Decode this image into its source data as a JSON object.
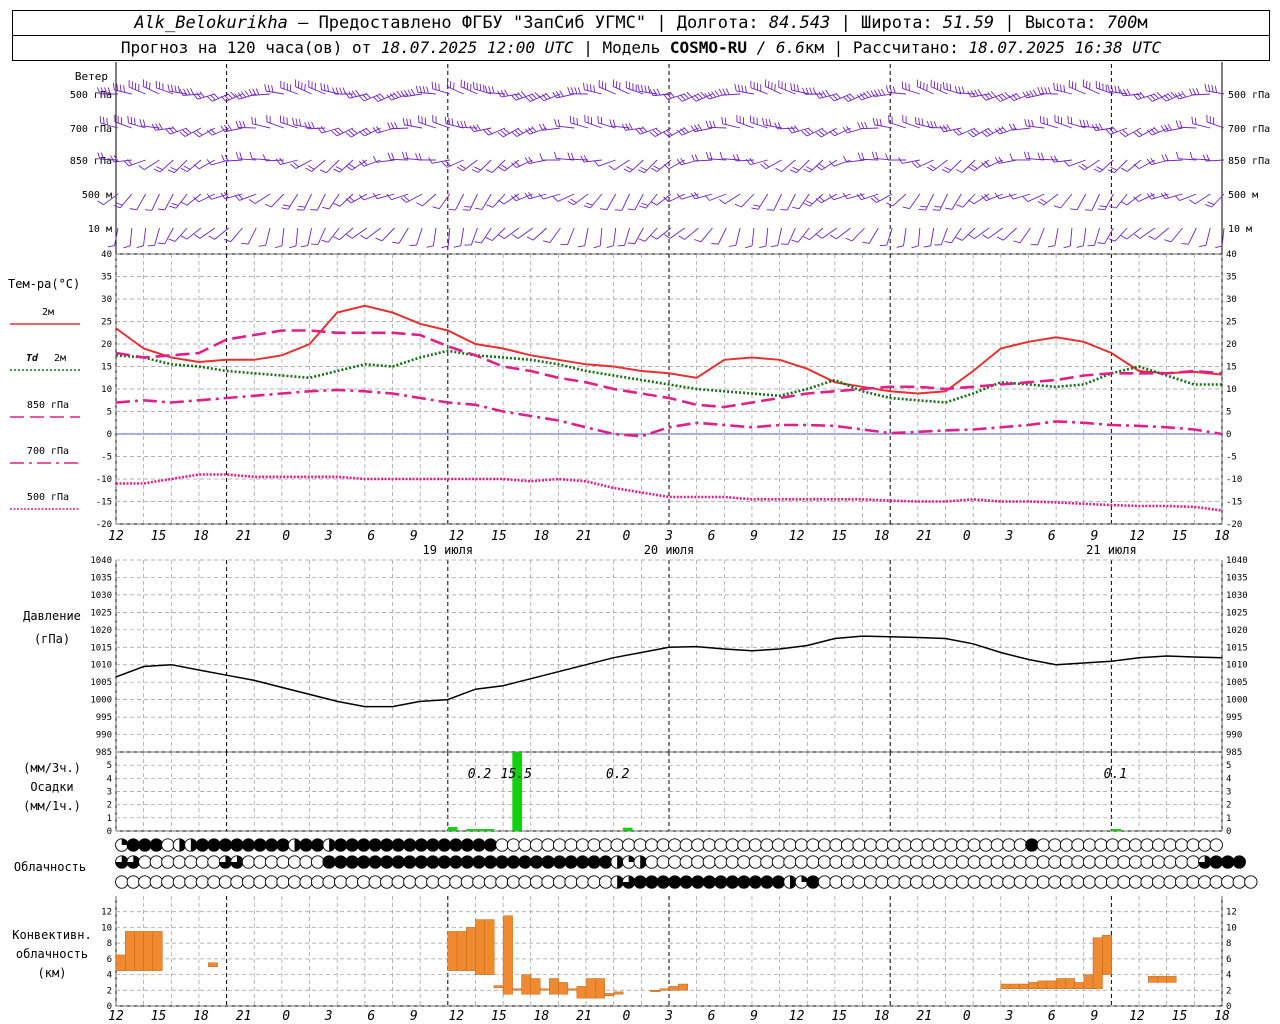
{
  "header": {
    "station": "Alk_Belokurikha",
    "provider": " – Предоставлено ФГБУ \"ЗапСиб УГМС\" | Долгота: ",
    "lon": "84.543",
    "lat_label": " | Широта: ",
    "lat": "51.59",
    "alt_label": " | Высота: ",
    "alt": "700",
    "alt_unit": "м",
    "forecast_label": "Прогноз на 120 часа(ов) от ",
    "start": "18.07.2025 12:00 UTC",
    "model_label": "  | Модель ",
    "model": "COSMO-RU",
    "res": " / 6.6",
    "res_unit": "км",
    "calc_label": " | Рассчитано: ",
    "calc": "18.07.2025 16:38 UTC"
  },
  "colors": {
    "wind": "#7020c0",
    "t2m": "#e83030",
    "td2m": "#157015",
    "t850": "#e0208a",
    "t700": "#e0208a",
    "t500": "#e0208a",
    "pressure": "#000000",
    "precip": "#10d010",
    "conv": "#f08a30",
    "zero_line": "#3030d0",
    "grid": "#999999"
  },
  "chart_data": [
    {
      "type": "wind_barbs",
      "title": "Ветер",
      "levels": [
        "500 гПа",
        "700 гПа",
        "850 гПа",
        "500 м",
        "10  м"
      ],
      "level_speed_ms": [
        18,
        14,
        9,
        6,
        4
      ],
      "level_dir_deg": [
        270,
        265,
        250,
        230,
        210
      ]
    },
    {
      "type": "line",
      "title": "Тем-ра(°С)",
      "ylim": [
        -20,
        40
      ],
      "yticks": [
        -20,
        -15,
        -10,
        -5,
        0,
        5,
        10,
        15,
        20,
        25,
        30,
        35,
        40
      ],
      "x_hours": [
        0,
        3,
        6,
        9,
        12,
        15,
        18,
        21,
        24,
        27,
        30,
        33,
        36,
        39,
        42,
        45,
        48,
        51,
        54,
        57,
        60,
        63,
        66,
        69,
        72,
        75,
        78,
        81,
        84,
        87,
        90,
        93,
        96,
        99,
        102,
        105,
        108,
        111,
        114,
        117,
        120
      ],
      "series": [
        {
          "name": "2м",
          "key": "t2m",
          "style": "solid",
          "values": [
            23.5,
            19,
            17,
            16,
            16.5,
            16.5,
            17.5,
            20,
            27,
            28.5,
            27,
            24.5,
            23,
            20,
            19,
            17.5,
            16.5,
            15.5,
            15,
            14,
            13.5,
            12.5,
            16.5,
            17,
            16.5,
            14.5,
            11.5,
            10.5,
            9.5,
            9,
            9.5,
            14,
            19,
            20.5,
            21.5,
            20.5,
            18,
            14,
            13.5,
            13.8,
            13.2
          ]
        },
        {
          "name": "Td 2м",
          "key": "td2m",
          "style": "dot",
          "values": [
            17.5,
            17,
            15.5,
            15,
            14,
            13.5,
            13,
            12.5,
            14,
            15.5,
            15,
            17,
            18.5,
            17.5,
            17,
            16.5,
            15.5,
            14,
            13,
            12,
            11,
            10,
            9.5,
            9,
            8.5,
            10,
            12,
            9.5,
            8,
            7.5,
            7,
            9,
            11.5,
            11,
            10.5,
            11,
            13.5,
            15,
            13,
            11,
            11
          ]
        },
        {
          "name": "850 гПа",
          "key": "t850",
          "style": "dash",
          "values": [
            18,
            17,
            17.5,
            18,
            21,
            22,
            23,
            23,
            22.5,
            22.5,
            22.5,
            22,
            19.5,
            17.5,
            15,
            14,
            12.5,
            11.5,
            10,
            9,
            8,
            6.5,
            6,
            7,
            8,
            9,
            9.5,
            10,
            10.5,
            10.5,
            10,
            10.5,
            11,
            11.5,
            12,
            13,
            13.5,
            13.5,
            13.5,
            14,
            13.5
          ]
        },
        {
          "name": "700 гПа",
          "key": "t700",
          "style": "dashdot",
          "values": [
            7,
            7.5,
            7,
            7.5,
            8,
            8.5,
            9,
            9.5,
            9.8,
            9.5,
            9,
            8,
            7,
            6.5,
            5,
            4,
            3,
            1.5,
            0,
            -0.5,
            1.5,
            2.5,
            2,
            1.5,
            2,
            2,
            1.8,
            1,
            0.2,
            0.5,
            0.8,
            1,
            1.5,
            2,
            2.8,
            2.5,
            2,
            1.8,
            1.5,
            1,
            0
          ]
        },
        {
          "name": "500 гПа",
          "key": "t500",
          "style": "dense",
          "values": [
            -11,
            -11,
            -10,
            -9,
            -9,
            -9.5,
            -9.5,
            -9.5,
            -9.5,
            -10,
            -10,
            -10,
            -10,
            -10,
            -10,
            -10.5,
            -10,
            -10.5,
            -12,
            -13,
            -14,
            -14,
            -14,
            -14.5,
            -14.5,
            -14.5,
            -14.5,
            -14.5,
            -14.8,
            -15,
            -15,
            -14.5,
            -15,
            -15,
            -15.2,
            -15.5,
            -15.8,
            -16,
            -16,
            -16.2,
            -17
          ]
        }
      ]
    },
    {
      "type": "line",
      "title": "Давление",
      "ylabel": "(гПа)",
      "ylim": [
        985,
        1040
      ],
      "yticks": [
        985,
        990,
        995,
        1000,
        1005,
        1010,
        1015,
        1020,
        1025,
        1030,
        1035,
        1040
      ],
      "x_hours": [
        0,
        3,
        6,
        9,
        12,
        15,
        18,
        21,
        24,
        27,
        30,
        33,
        36,
        39,
        42,
        45,
        48,
        51,
        54,
        57,
        60,
        63,
        66,
        69,
        72,
        75,
        78,
        81,
        84,
        87,
        90,
        93,
        96,
        99,
        102,
        105,
        108,
        111,
        114,
        117,
        120
      ],
      "series": [
        {
          "name": "Давление",
          "key": "pressure",
          "values": [
            1006.5,
            1009.5,
            1010,
            1008.5,
            1007,
            1005.5,
            1003.5,
            1001.5,
            999.5,
            998,
            998,
            999.5,
            1000,
            1003,
            1004,
            1006,
            1008,
            1010,
            1012,
            1013.5,
            1015,
            1015.2,
            1014.5,
            1014,
            1014.5,
            1015.5,
            1017.5,
            1018.2,
            1018,
            1017.8,
            1017.5,
            1016,
            1013.5,
            1011.5,
            1010,
            1010.5,
            1011,
            1012,
            1012.5,
            1012.2,
            1012
          ]
        }
      ]
    },
    {
      "type": "bar",
      "title": "Осадки",
      "ylabel_3h": "(мм/3ч.)",
      "ylabel_1h": "(мм/1ч.)",
      "ylim": [
        0,
        6
      ],
      "yticks": [
        0,
        1,
        2,
        3,
        4,
        5
      ],
      "bars": [
        {
          "h": 36,
          "v": 0.3
        },
        {
          "h": 38,
          "v": 0.15
        },
        {
          "h": 39,
          "v": 0.15
        },
        {
          "h": 40,
          "v": 0.15
        },
        {
          "h": 43,
          "v": 6
        },
        {
          "h": 55,
          "v": 0.25
        },
        {
          "h": 108,
          "v": 0.15
        }
      ],
      "labels": [
        {
          "h": 39,
          "text": "0.2"
        },
        {
          "h": 43,
          "text": "15.5"
        },
        {
          "h": 54,
          "text": "0.2"
        },
        {
          "h": 108,
          "text": "0.1"
        }
      ]
    },
    {
      "type": "symbols",
      "title": "Облачность",
      "rows": [
        "QFFFOHHFFFFFFFFHFFHFFFFFFFFFFFFFFOOOOOOOOOOOOOOOOOOOOOOOOOOOOOOOOOOOOOOOOOOOOOOFOOOOOOOOOOOOOOOO",
        "TTOOOOOOOTTOOOOOOOFFFFFFFFFFFFFFFFFFFFFFFFFHQHOOOOOOOOOOOOOOOOOOOOOOOOOOOOOOOOOOOOOOOOOOOOOOOOTFFF",
        "OOOOOOOOOOOOOOOOOOOOOOOOOOOOOOOOOOOOOOOOOOOHTFFFFFFFFFFFFFHQFOOOOOOOOOOOOOOOOOOOOOOOOOOOOOOOOOOOOOO"
      ]
    },
    {
      "type": "bar",
      "title": "Конвективн.",
      "title2": "облачность",
      "ylabel": "(км)",
      "ylim": [
        0,
        14
      ],
      "yticks": [
        0,
        2,
        4,
        6,
        8,
        10,
        12
      ],
      "bars": [
        {
          "h": 0,
          "bottom": 4.5,
          "top": 6.5
        },
        {
          "h": 1,
          "bottom": 4.5,
          "top": 9.5
        },
        {
          "h": 2,
          "bottom": 4.5,
          "top": 9.5
        },
        {
          "h": 3,
          "bottom": 4.5,
          "top": 9.5
        },
        {
          "h": 4,
          "bottom": 4.5,
          "top": 9.5
        },
        {
          "h": 10,
          "bottom": 5,
          "top": 5.5
        },
        {
          "h": 36,
          "bottom": 4.5,
          "top": 9.5
        },
        {
          "h": 37,
          "bottom": 4.5,
          "top": 9.5
        },
        {
          "h": 38,
          "bottom": 4.5,
          "top": 10
        },
        {
          "h": 39,
          "bottom": 4,
          "top": 11
        },
        {
          "h": 40,
          "bottom": 4,
          "top": 11
        },
        {
          "h": 41,
          "bottom": 2.3,
          "top": 2.6
        },
        {
          "h": 42,
          "bottom": 1.5,
          "top": 11.5
        },
        {
          "h": 43,
          "bottom": 2,
          "top": 2.2
        },
        {
          "h": 44,
          "bottom": 1.5,
          "top": 4
        },
        {
          "h": 45,
          "bottom": 1.5,
          "top": 3.5
        },
        {
          "h": 46,
          "bottom": 2,
          "top": 2.2
        },
        {
          "h": 47,
          "bottom": 1.5,
          "top": 3.5
        },
        {
          "h": 48,
          "bottom": 1.5,
          "top": 3
        },
        {
          "h": 49,
          "bottom": 2,
          "top": 2.2
        },
        {
          "h": 50,
          "bottom": 1,
          "top": 2.5
        },
        {
          "h": 51,
          "bottom": 1,
          "top": 3.5
        },
        {
          "h": 52,
          "bottom": 1,
          "top": 3.5
        },
        {
          "h": 53,
          "bottom": 1.3,
          "top": 1.6
        },
        {
          "h": 54,
          "bottom": 1.5,
          "top": 1.8
        },
        {
          "h": 58,
          "bottom": 1.8,
          "top": 2
        },
        {
          "h": 59,
          "bottom": 2,
          "top": 2.2
        },
        {
          "h": 60,
          "bottom": 2,
          "top": 2.5
        },
        {
          "h": 61,
          "bottom": 2,
          "top": 2.8
        },
        {
          "h": 96,
          "bottom": 2.2,
          "top": 2.8
        },
        {
          "h": 97,
          "bottom": 2.2,
          "top": 2.8
        },
        {
          "h": 98,
          "bottom": 2.2,
          "top": 2.8
        },
        {
          "h": 99,
          "bottom": 2.2,
          "top": 3
        },
        {
          "h": 100,
          "bottom": 2.2,
          "top": 3.2
        },
        {
          "h": 101,
          "bottom": 2.2,
          "top": 3.2
        },
        {
          "h": 102,
          "bottom": 2.2,
          "top": 3.5
        },
        {
          "h": 103,
          "bottom": 2.2,
          "top": 3.5
        },
        {
          "h": 104,
          "bottom": 2.2,
          "top": 3
        },
        {
          "h": 105,
          "bottom": 2.2,
          "top": 4
        },
        {
          "h": 106,
          "bottom": 2.2,
          "top": 8.7
        },
        {
          "h": 107,
          "bottom": 4,
          "top": 9
        },
        {
          "h": 112,
          "bottom": 3,
          "top": 3.8
        },
        {
          "h": 113,
          "bottom": 3,
          "top": 3.8
        },
        {
          "h": 114,
          "bottom": 3,
          "top": 3.8
        }
      ]
    }
  ],
  "x_axis": {
    "ticks": [
      "12",
      "15",
      "18",
      "21",
      "0",
      "3",
      "6",
      "9",
      "12",
      "15",
      "18",
      "21",
      "0",
      "3",
      "6",
      "9",
      "12",
      "15",
      "18",
      "21",
      "0",
      "3",
      "6",
      "9",
      "12",
      "15",
      "18"
    ],
    "days": [
      {
        "h": 36,
        "label": "19 июля"
      },
      {
        "h": 60,
        "label": "20 июля"
      },
      {
        "h": 108,
        "label": "21 июля"
      }
    ]
  },
  "legend": {
    "t2m": "2м",
    "td2m_a": "Td",
    "td2m_b": "2м",
    "t850": "850 гПа",
    "t700": "700 гПа",
    "t500": "500 гПа"
  }
}
